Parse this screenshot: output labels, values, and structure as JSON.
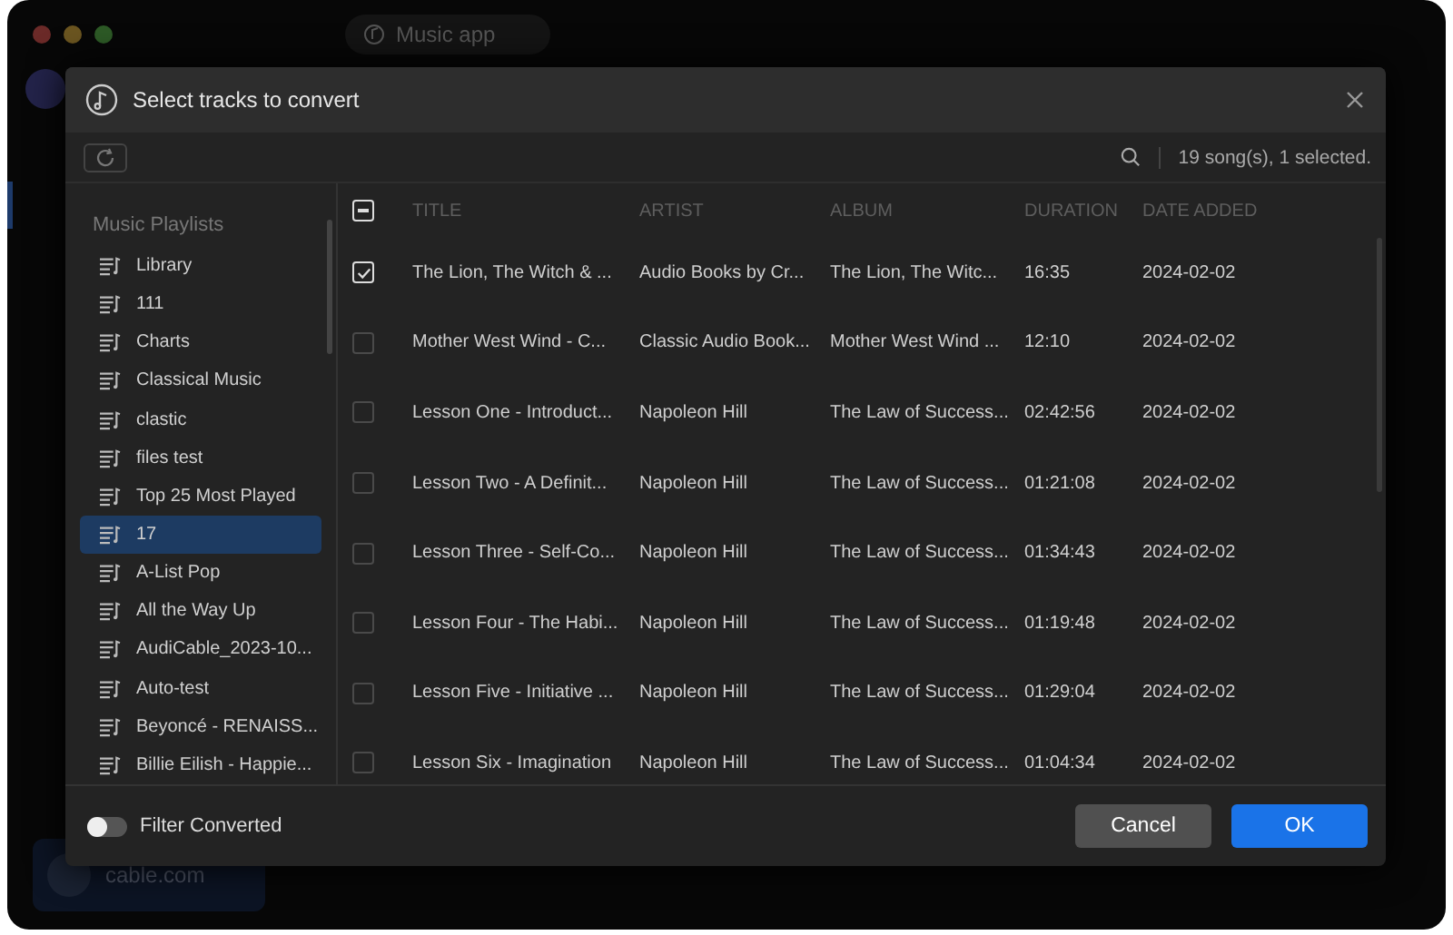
{
  "app": {
    "title": "Music app",
    "account": "cable.com"
  },
  "dialog": {
    "title": "Select tracks to convert",
    "summary": "19 song(s), 1 selected."
  },
  "sidebar": {
    "heading": "Music Playlists",
    "items": [
      {
        "label": "Library",
        "selected": false
      },
      {
        "label": "111",
        "selected": false
      },
      {
        "label": "Charts",
        "selected": false
      },
      {
        "label": "Classical Music",
        "selected": false
      },
      {
        "label": "clastic",
        "selected": false
      },
      {
        "label": "files test",
        "selected": false
      },
      {
        "label": "Top 25 Most Played",
        "selected": false
      },
      {
        "label": "17",
        "selected": true
      },
      {
        "label": "A-List Pop",
        "selected": false
      },
      {
        "label": "All the Way Up",
        "selected": false
      },
      {
        "label": "AudiCable_2023-10...",
        "selected": false
      },
      {
        "label": "Auto-test",
        "selected": false
      },
      {
        "label": "Beyoncé - RENAISS...",
        "selected": false
      },
      {
        "label": "Billie Eilish - Happie...",
        "selected": false
      }
    ]
  },
  "table": {
    "select_all_partial": true,
    "columns": [
      "TITLE",
      "ARTIST",
      "ALBUM",
      "DURATION",
      "DATE ADDED"
    ],
    "rows": [
      {
        "checked": true,
        "cells": [
          "The Lion, The Witch & ...",
          "Audio Books by Cr...",
          "The Lion, The Witc...",
          "16:35",
          "2024-02-02"
        ]
      },
      {
        "checked": false,
        "cells": [
          "Mother West Wind - C...",
          "Classic Audio Book...",
          "Mother West Wind ...",
          "12:10",
          "2024-02-02"
        ]
      },
      {
        "checked": false,
        "cells": [
          "Lesson One - Introduct...",
          "Napoleon Hill",
          "The Law of Success...",
          "02:42:56",
          "2024-02-02"
        ]
      },
      {
        "checked": false,
        "cells": [
          "Lesson Two - A Definit...",
          "Napoleon Hill",
          "The Law of Success...",
          "01:21:08",
          "2024-02-02"
        ]
      },
      {
        "checked": false,
        "cells": [
          "Lesson Three - Self-Co...",
          "Napoleon Hill",
          "The Law of Success...",
          "01:34:43",
          "2024-02-02"
        ]
      },
      {
        "checked": false,
        "cells": [
          "Lesson Four - The Habi...",
          "Napoleon Hill",
          "The Law of Success...",
          "01:19:48",
          "2024-02-02"
        ]
      },
      {
        "checked": false,
        "cells": [
          "Lesson Five - Initiative ...",
          "Napoleon Hill",
          "The Law of Success...",
          "01:29:04",
          "2024-02-02"
        ]
      },
      {
        "checked": false,
        "cells": [
          "Lesson Six - Imagination",
          "Napoleon Hill",
          "The Law of Success...",
          "01:04:34",
          "2024-02-02"
        ]
      }
    ]
  },
  "footer": {
    "toggle": {
      "label": "Filter Converted",
      "on": false
    },
    "buttons": [
      "Cancel",
      "OK"
    ]
  }
}
